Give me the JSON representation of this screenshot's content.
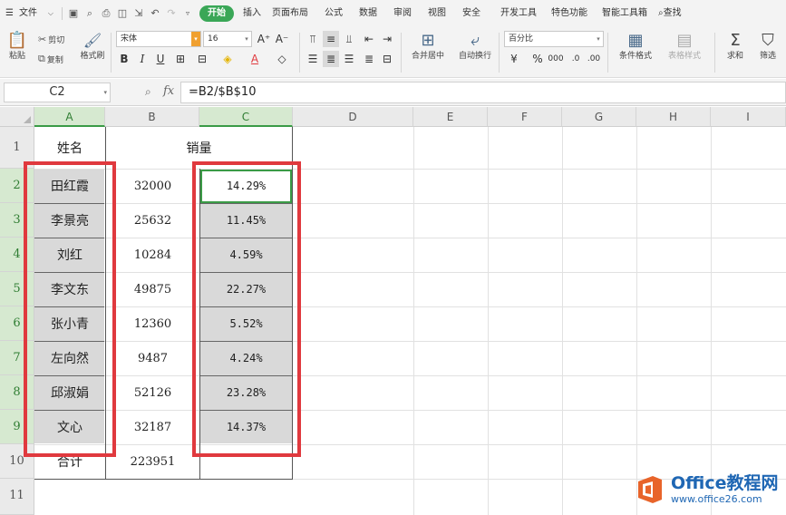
{
  "menubar": {
    "file": "文件",
    "tabs": [
      "开始",
      "插入",
      "页面布局",
      "公式",
      "数据",
      "审阅",
      "视图",
      "安全",
      "开发工具",
      "特色功能",
      "智能工具箱"
    ],
    "active_tab": "开始",
    "search": "查找"
  },
  "ribbon": {
    "paste": "粘贴",
    "cut": "剪切",
    "copy": "复制",
    "format_painter": "格式刷",
    "font_name": "宋体",
    "font_size": "16",
    "merge_center": "合并居中",
    "wrap_text": "自动换行",
    "number_format": "百分比",
    "conditional_format": "条件格式",
    "table_style": "表格样式",
    "sum": "求和",
    "filter": "筛选"
  },
  "formula_bar": {
    "cell_ref": "C2",
    "fx": "fx",
    "formula": "=B2/$B$10"
  },
  "sheet": {
    "columns": [
      "A",
      "B",
      "C",
      "D",
      "E",
      "F",
      "G",
      "H",
      "I"
    ],
    "rows": [
      "1",
      "2",
      "3",
      "4",
      "5",
      "6",
      "7",
      "8",
      "9",
      "10",
      "11"
    ],
    "header_name": "姓名",
    "header_sales": "销量",
    "data": [
      {
        "name": "田红霞",
        "sales": "32000",
        "pct": "14.29%"
      },
      {
        "name": "李景亮",
        "sales": "25632",
        "pct": "11.45%"
      },
      {
        "name": "刘红",
        "sales": "10284",
        "pct": "4.59%"
      },
      {
        "name": "李文东",
        "sales": "49875",
        "pct": "22.27%"
      },
      {
        "name": "张小青",
        "sales": "12360",
        "pct": "5.52%"
      },
      {
        "name": "左向然",
        "sales": "9487",
        "pct": "4.24%"
      },
      {
        "name": "邱淑娟",
        "sales": "52126",
        "pct": "23.28%"
      },
      {
        "name": "文心",
        "sales": "32187",
        "pct": "14.37%"
      }
    ],
    "total_label": "合计",
    "total_value": "223951"
  },
  "watermark": {
    "title": "Office教程网",
    "url": "www.office26.com"
  },
  "colors": {
    "accent_green": "#3aa757",
    "highlight_red": "#e0393e",
    "cell_gray": "#d9d9d9"
  }
}
